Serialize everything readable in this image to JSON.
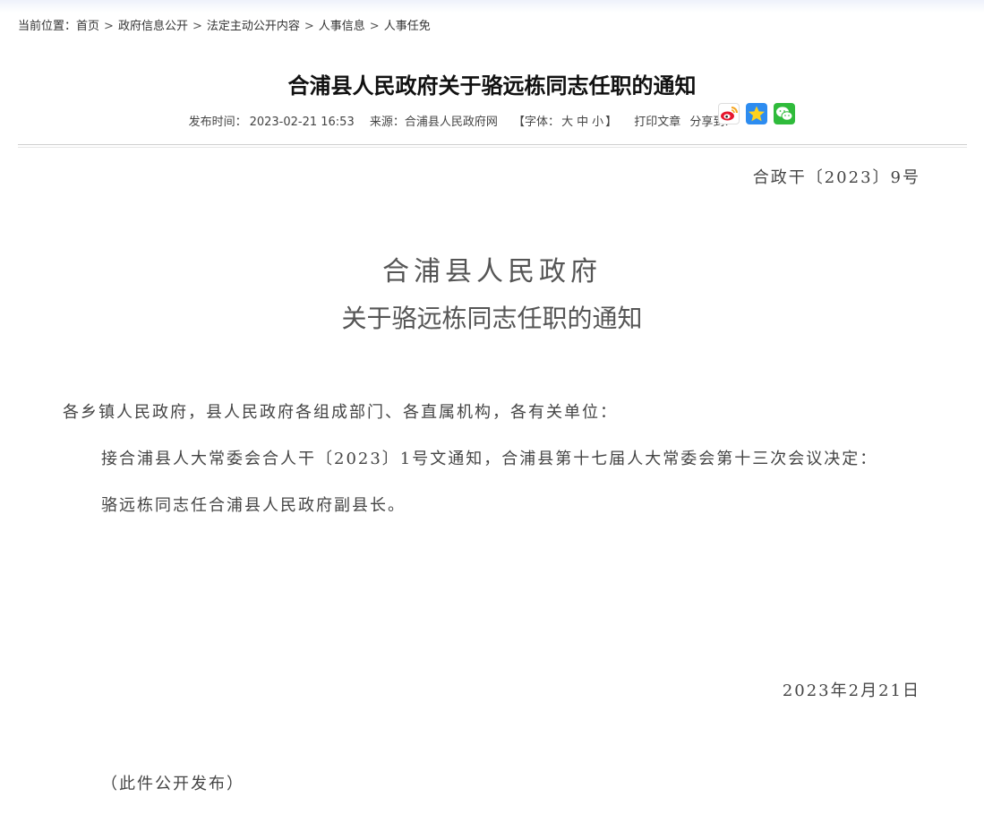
{
  "breadcrumb": {
    "prefix": "当前位置：",
    "items": [
      "首页",
      "政府信息公开",
      "法定主动公开内容",
      "人事信息",
      "人事任免"
    ],
    "separator": ">"
  },
  "article": {
    "title": "合浦县人民政府关于骆远栋同志任职的通知"
  },
  "meta": {
    "publish_label": "发布时间：",
    "publish_time": "2023-02-21 16:53",
    "source_label": "来源：",
    "source": "合浦县人民政府网",
    "font_label_open": "【字体：",
    "font_large": "大",
    "font_medium": "中",
    "font_small": "小",
    "font_label_close": "】",
    "print_label": "打印文章",
    "share_label": "分享到:"
  },
  "share": {
    "icons": [
      "weibo-icon",
      "qzone-icon",
      "wechat-icon"
    ]
  },
  "document": {
    "number": "合政干〔2023〕9号",
    "issuer": "合浦县人民政府",
    "subject": "关于骆远栋同志任职的通知",
    "salutation": "各乡镇人民政府，县人民政府各组成部门、各直属机构，各有关单位：",
    "paragraphs": [
      "接合浦县人大常委会合人干〔2023〕1号文通知，合浦县第十七届人大常委会第十三次会议决定：",
      "骆远栋同志任合浦县人民政府副县长。"
    ],
    "date": "2023年2月21日",
    "note": "（此件公开发布）"
  },
  "colors": {
    "title": "#111111",
    "body": "#444444",
    "divider": "#cfcfcf"
  }
}
